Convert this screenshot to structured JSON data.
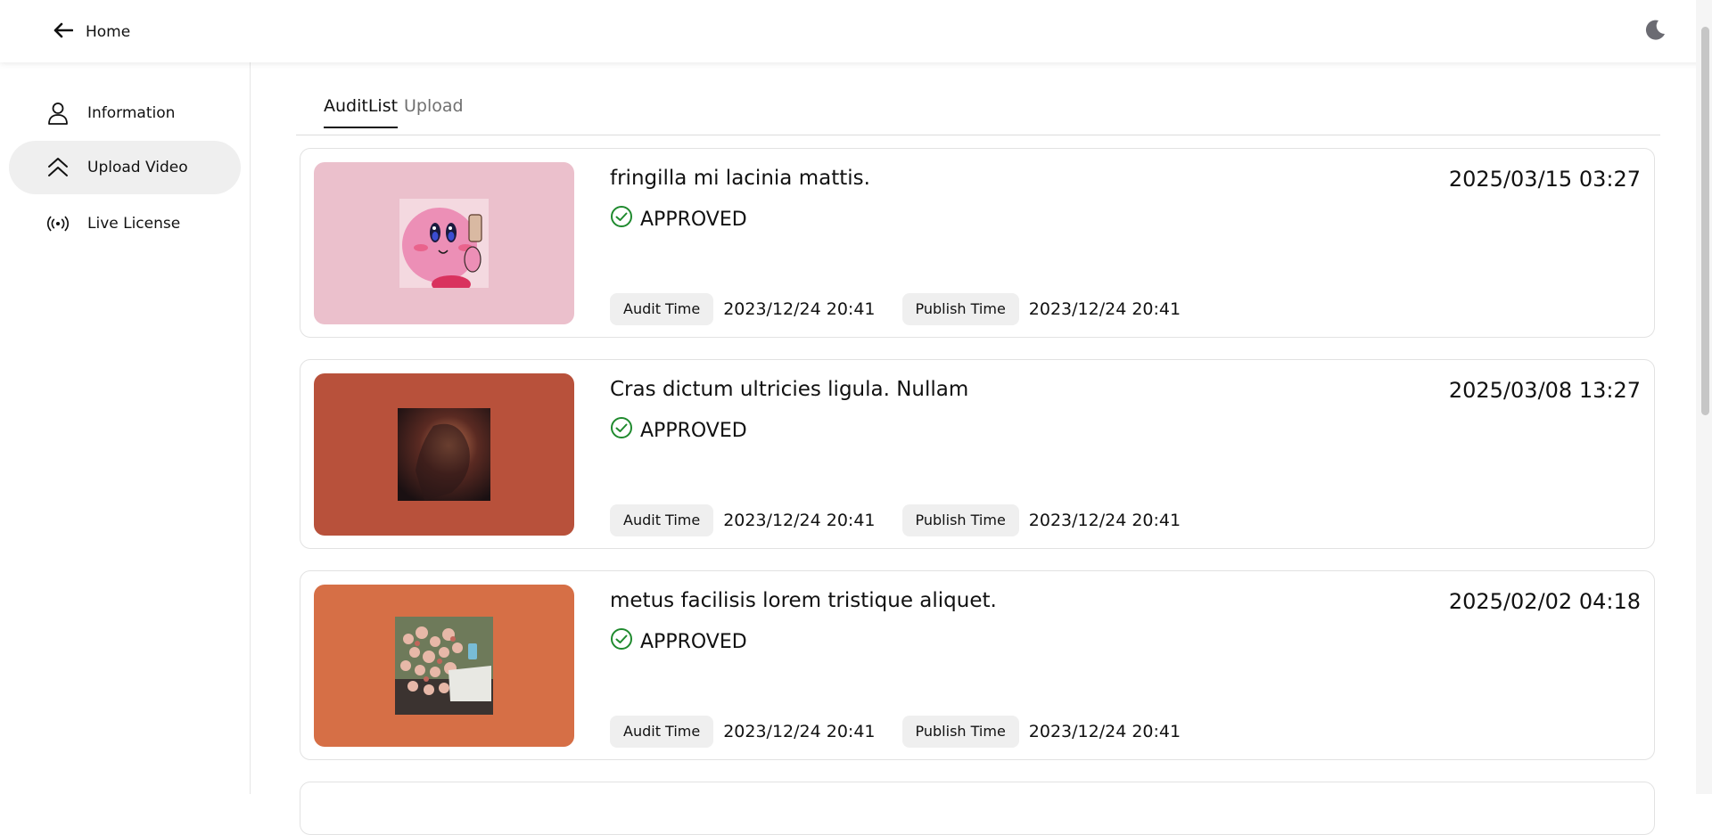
{
  "header": {
    "home_label": "Home"
  },
  "sidebar": {
    "items": [
      {
        "label": "Information",
        "icon": "user-icon"
      },
      {
        "label": "Upload Video",
        "icon": "chevrons-up-icon",
        "active": true
      },
      {
        "label": "Live License",
        "icon": "broadcast-icon"
      }
    ]
  },
  "tabs": [
    {
      "label": "AuditList",
      "active": true
    },
    {
      "label": "Upload",
      "active": false
    }
  ],
  "cards": [
    {
      "title": "fringilla mi lacinia mattis.",
      "date": "2025/03/15 03:27",
      "status": "APPROVED",
      "audit_label": "Audit Time",
      "audit_time": "2023/12/24 20:41",
      "publish_label": "Publish Time",
      "publish_time": "2023/12/24 20:41",
      "thumb_color": "#ebc0cc"
    },
    {
      "title": "Cras dictum ultricies ligula. Nullam",
      "date": "2025/03/08 13:27",
      "status": "APPROVED",
      "audit_label": "Audit Time",
      "audit_time": "2023/12/24 20:41",
      "publish_label": "Publish Time",
      "publish_time": "2023/12/24 20:41",
      "thumb_color": "#b8513b"
    },
    {
      "title": "metus facilisis lorem tristique aliquet.",
      "date": "2025/02/02 04:18",
      "status": "APPROVED",
      "audit_label": "Audit Time",
      "audit_time": "2023/12/24 20:41",
      "publish_label": "Publish Time",
      "publish_time": "2023/12/24 20:41",
      "thumb_color": "#d66f46"
    }
  ],
  "colors": {
    "approved_green": "#1f8a2e",
    "active_bg": "#efefef"
  }
}
